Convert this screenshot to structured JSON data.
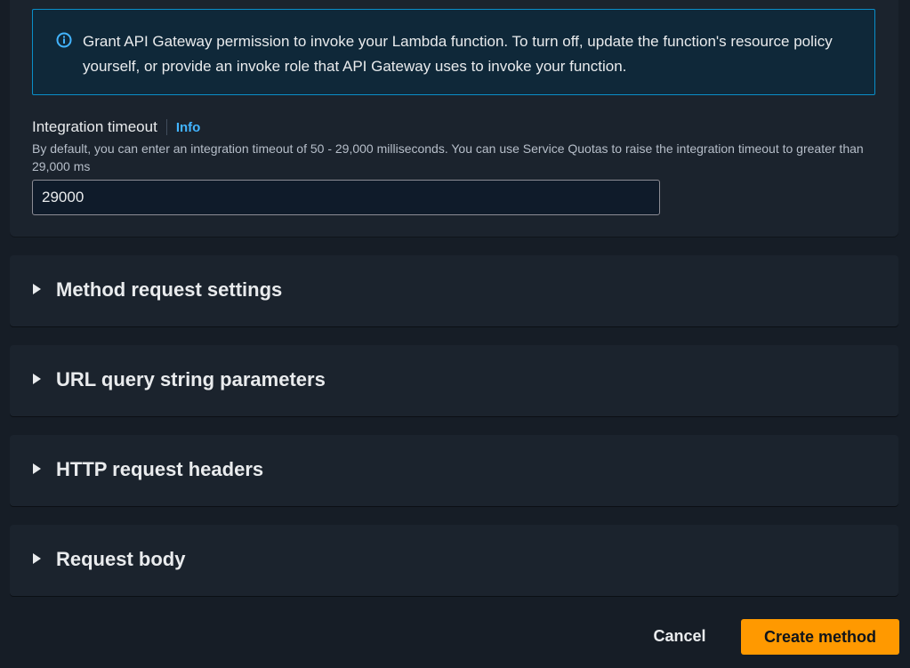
{
  "alert": {
    "icon": "info-icon",
    "message": "Grant API Gateway permission to invoke your Lambda function. To turn off, update the function's resource policy yourself, or provide an invoke role that API Gateway uses to invoke your function.",
    "border_color": "#0a8ec8"
  },
  "integration_timeout": {
    "label": "Integration timeout",
    "info_link": "Info",
    "description": "By default, you can enter an integration timeout of 50 - 29,000 milliseconds. You can use Service Quotas to raise the integration timeout to greater than 29,000 ms",
    "value": "29000"
  },
  "sections": [
    {
      "title": "Method request settings",
      "icon": "caret-right-icon"
    },
    {
      "title": "URL query string parameters",
      "icon": "caret-right-icon"
    },
    {
      "title": "HTTP request headers",
      "icon": "caret-right-icon"
    },
    {
      "title": "Request body",
      "icon": "caret-right-icon"
    }
  ],
  "actions": {
    "cancel_label": "Cancel",
    "create_label": "Create method",
    "primary_color": "#ff9900"
  }
}
